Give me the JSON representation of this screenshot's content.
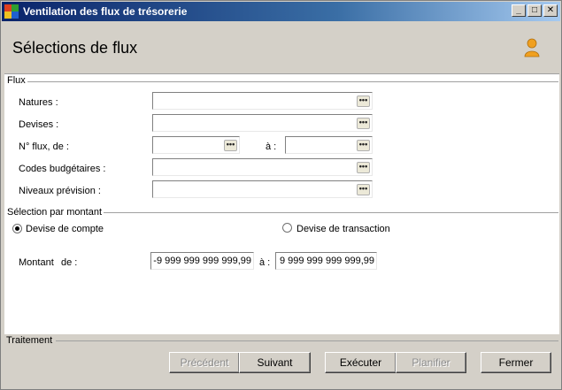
{
  "window": {
    "title": "Ventilation des flux de trésorerie",
    "icon": "app-grid-icon"
  },
  "titlebar_buttons": {
    "minimize": "_",
    "maximize": "□",
    "close": "✕"
  },
  "header": {
    "title": "Sélections de flux",
    "icon": "user-icon"
  },
  "flux": {
    "section_title": "Flux",
    "natures_label": "Natures :",
    "devises_label": "Devises :",
    "nflux_label": "N° flux, de :",
    "nflux_to_label": "à :",
    "codes_label": "Codes budgétaires :",
    "niveaux_label": "Niveaux prévision :",
    "browse_glyph": "•••"
  },
  "montant": {
    "section_title": "Sélection par montant",
    "radio_compte": "Devise de compte",
    "radio_transaction": "Devise de transaction",
    "selected": "Devise de compte",
    "montant_label": "Montant",
    "de_label": "de :",
    "to_label": "à :",
    "min_value": "-9 999 999 999 999,99",
    "max_value": "9 999 999 999 999,99"
  },
  "traitement": {
    "section_title": "Traitement",
    "precedent": "Précédent",
    "suivant": "Suivant",
    "executer": "Exécuter",
    "planifier": "Planifier",
    "fermer": "Fermer"
  },
  "colors": {
    "title_start": "#0a246a",
    "title_end": "#a6caf0",
    "user_icon": "#f0a020"
  }
}
